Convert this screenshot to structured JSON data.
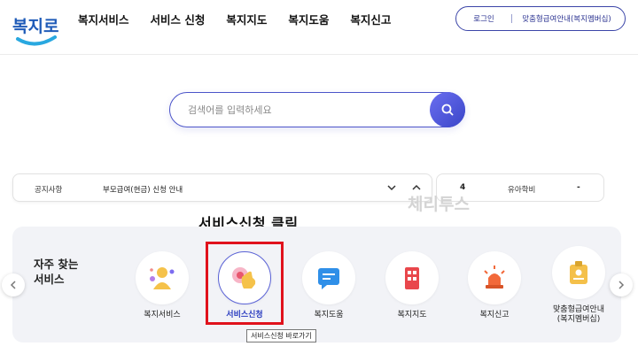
{
  "header": {
    "logo_text": "복지로",
    "nav": [
      "복지서비스",
      "서비스 신청",
      "복지지도",
      "복지도움",
      "복지신고"
    ],
    "login": "로그인",
    "guide": "맞춤형급여안내(복지멤버십)"
  },
  "search": {
    "placeholder": "검색어를 입력하세요"
  },
  "notice": {
    "label": "공지사항",
    "text": "부모급여(현금) 신청 안내"
  },
  "stats": {
    "number": "4",
    "label": "유아학비",
    "value": "-"
  },
  "annotation": "서비스신청 클릭",
  "watermark": "체리투스",
  "frequent": {
    "title": "자주 찾는\n서비스",
    "items": [
      {
        "label": "복지서비스",
        "icon": "people-icon"
      },
      {
        "label": "서비스신청",
        "icon": "hand-click-icon",
        "active": true
      },
      {
        "label": "복지도움",
        "icon": "chat-icon"
      },
      {
        "label": "복지지도",
        "icon": "building-icon"
      },
      {
        "label": "복지신고",
        "icon": "siren-icon"
      },
      {
        "label": "맞춤형급여안내\n(복지멤버십)",
        "icon": "badge-icon"
      }
    ]
  },
  "tooltip": "서비스신청 바로가기",
  "colors": {
    "accent": "#3b45a8",
    "highlight": "#e0121c",
    "panel": "#f2f3f7"
  }
}
